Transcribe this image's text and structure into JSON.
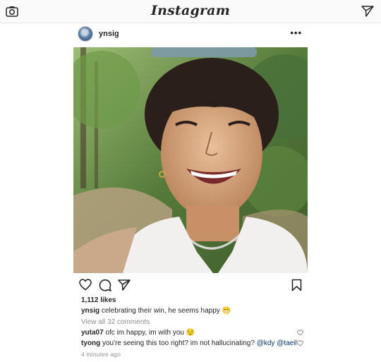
{
  "app": {
    "logo": "Instagram",
    "camera_icon": "camera-icon",
    "send_icon": "paper-plane-icon"
  },
  "post": {
    "username": "ynsig",
    "more_label": "•••",
    "likes": "1,112 likes",
    "caption": {
      "user": "ynsig",
      "text": "celebrating their win, he seems happy 😁"
    },
    "view_comments": "View all 32 comments",
    "comments": [
      {
        "user": "yuta07",
        "text": "ofc im happy, im with you 😌"
      },
      {
        "user": "tyong",
        "text": "you're seeing this too right? im not hallucinating?",
        "mentions": "@kdy @taeil"
      }
    ],
    "time": "4 minutes ago"
  },
  "colors": {
    "accent_link": "#00376b",
    "muted": "#8e8e8e",
    "text": "#262626"
  }
}
